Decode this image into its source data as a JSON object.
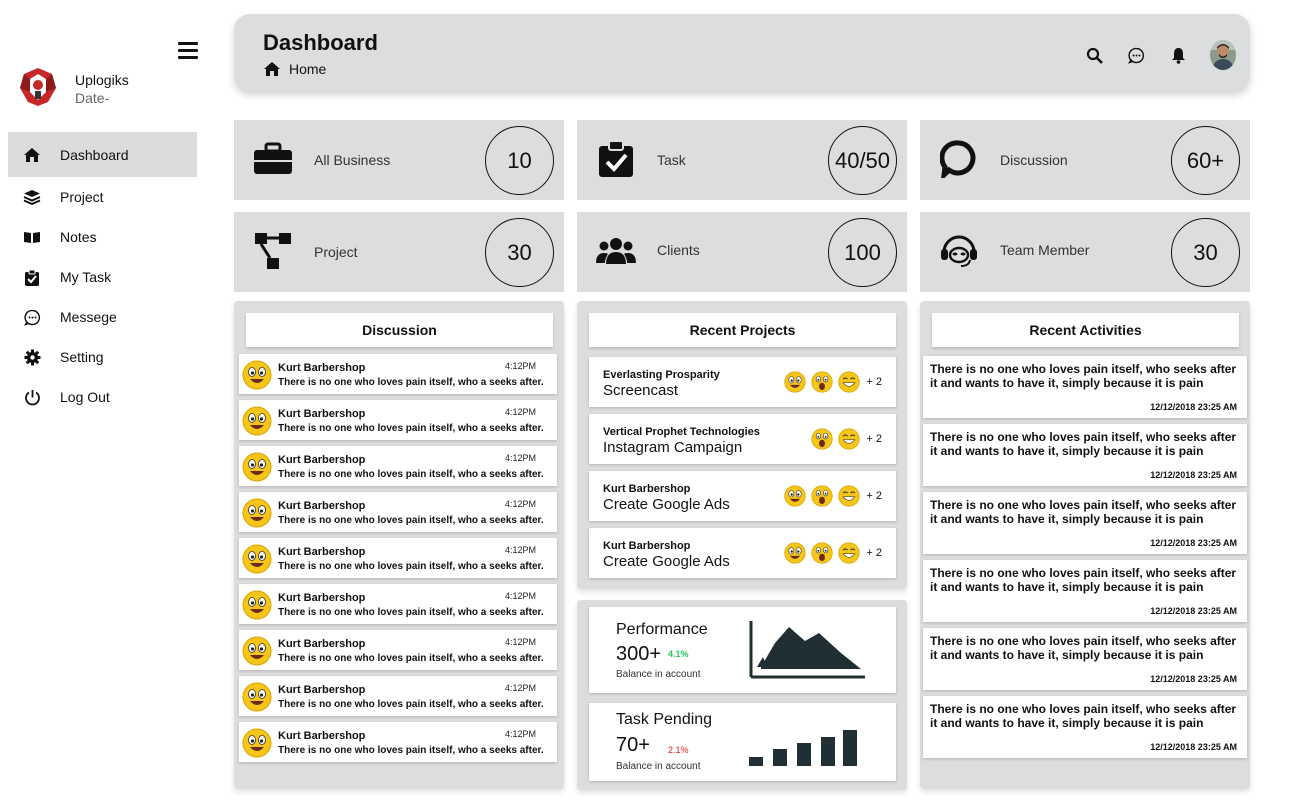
{
  "sidebar": {
    "brand_name": "Uplogiks",
    "brand_date": "Date-",
    "items": [
      {
        "label": "Dashboard",
        "icon": "home-icon",
        "active": true
      },
      {
        "label": "Project",
        "icon": "layers-icon"
      },
      {
        "label": "Notes",
        "icon": "book-icon"
      },
      {
        "label": "My Task",
        "icon": "clipboard-check-icon"
      },
      {
        "label": "Messege",
        "icon": "chat-icon"
      },
      {
        "label": "Setting",
        "icon": "gear-icon"
      },
      {
        "label": "Log Out",
        "icon": "power-icon"
      }
    ]
  },
  "header": {
    "title": "Dashboard",
    "breadcrumb": "Home",
    "icons": [
      "search-icon",
      "chat-icon",
      "bell-icon",
      "avatar"
    ]
  },
  "stats": [
    {
      "label": "All Business",
      "value": "10",
      "icon": "briefcase-icon"
    },
    {
      "label": "Task",
      "value": "40/50",
      "icon": "clipboard-check-icon"
    },
    {
      "label": "Discussion",
      "value": "60+",
      "icon": "chat-bubble-icon"
    },
    {
      "label": "Project",
      "value": "30",
      "icon": "sitemap-icon"
    },
    {
      "label": "Clients",
      "value": "100",
      "icon": "users-icon"
    },
    {
      "label": "Team Member",
      "value": "30",
      "icon": "headset-icon"
    }
  ],
  "discussion": {
    "title": "Discussion",
    "items": [
      {
        "name": "Kurt Barbershop",
        "time": "4:12PM",
        "message": "There is no one who loves pain itself, who a seeks after."
      },
      {
        "name": "Kurt Barbershop",
        "time": "4:12PM",
        "message": "There is no one who loves pain itself, who a seeks after."
      },
      {
        "name": "Kurt Barbershop",
        "time": "4:12PM",
        "message": "There is no one who loves pain itself, who a seeks after."
      },
      {
        "name": "Kurt Barbershop",
        "time": "4:12PM",
        "message": "There is no one who loves pain itself, who a seeks after."
      },
      {
        "name": "Kurt Barbershop",
        "time": "4:12PM",
        "message": "There is no one who loves pain itself, who a seeks after."
      },
      {
        "name": "Kurt Barbershop",
        "time": "4:12PM",
        "message": "There is no one who loves pain itself, who a seeks after."
      },
      {
        "name": "Kurt Barbershop",
        "time": "4:12PM",
        "message": "There is no one who loves pain itself, who a seeks after."
      },
      {
        "name": "Kurt Barbershop",
        "time": "4:12PM",
        "message": "There is no one who loves pain itself, who a seeks after."
      },
      {
        "name": "Kurt Barbershop",
        "time": "4:12PM",
        "message": "There is no one who loves pain itself, who a seeks after."
      }
    ]
  },
  "projects": {
    "title": "Recent Projects",
    "items": [
      {
        "name": "Everlasting Prosparity",
        "title": "Screencast",
        "extra": "+ 2",
        "emojis": 3
      },
      {
        "name": "Vertical Prophet Technologies",
        "title": "Instagram Campaign",
        "extra": "+ 2",
        "emojis": 2
      },
      {
        "name": "Kurt Barbershop",
        "title": "Create Google Ads",
        "extra": "+ 2",
        "emojis": 3
      },
      {
        "name": "Kurt Barbershop",
        "title": "Create Google Ads",
        "extra": "+ 2",
        "emojis": 3
      }
    ]
  },
  "performance": {
    "title": "Performance",
    "value": "300+",
    "change": "4.1%",
    "change_color": "#22c55e",
    "subtitle": "Balance in account"
  },
  "task_pending": {
    "title": "Task Pending",
    "value": "70+",
    "change": "2.1%",
    "change_color": "#e11d1d",
    "subtitle": "Balance in account"
  },
  "activities": {
    "title": "Recent Activities",
    "items": [
      {
        "text": "There is no one who loves pain itself, who seeks after it and wants to have it, simply because it is pain",
        "date": "12/12/2018 23:25 AM"
      },
      {
        "text": "There is no one who loves pain itself, who seeks after it and wants to have it, simply because it is pain",
        "date": "12/12/2018 23:25 AM"
      },
      {
        "text": "There is no one who loves pain itself, who seeks after it and wants to have it, simply because it is pain",
        "date": "12/12/2018 23:25 AM"
      },
      {
        "text": "There is no one who loves pain itself, who seeks after it and wants to have it, simply because it is pain",
        "date": "12/12/2018 23:25 AM"
      },
      {
        "text": "There is no one who loves pain itself, who seeks after it and wants to have it, simply because it is pain",
        "date": "12/12/2018 23:25 AM"
      },
      {
        "text": "There is no one who loves pain itself, who seeks after it and wants to have it, simply because it is pain",
        "date": "12/12/2018 23:25 AM"
      }
    ]
  }
}
